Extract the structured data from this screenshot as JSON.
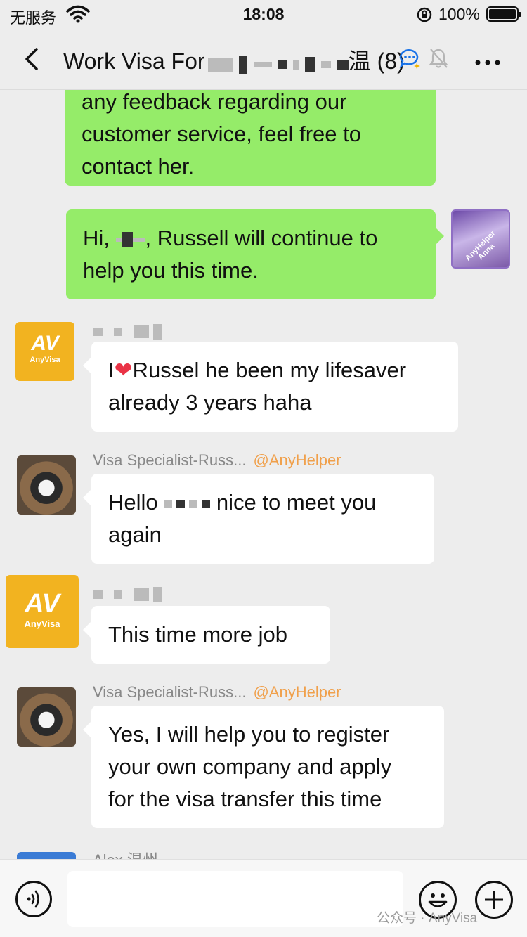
{
  "status_bar": {
    "carrier": "无服务",
    "time": "18:08",
    "battery": "100%"
  },
  "header": {
    "title_start": "Work Visa For",
    "title_end": "温",
    "member_count": "(8)"
  },
  "messages": [
    {
      "text_lines": [
        "any feedback regarding our",
        "customer service, feel free to",
        "contact her."
      ]
    },
    {
      "text_prefix": "Hi,",
      "text_rest": ", Russell will continue to",
      "text_line2": "help you this time."
    },
    {
      "line1_start": "I",
      "line1_rest": "Russel he been my lifesaver",
      "line2": "already 3 years haha"
    },
    {
      "sender": "Visa Specialist-Russ...",
      "mention": "@AnyHelper",
      "line1_start": "Hello",
      "line1_rest": "nice to meet you",
      "line2": "again"
    },
    {
      "text": "This time more job"
    },
    {
      "sender": "Visa Specialist-Russ...",
      "mention": "@AnyHelper",
      "lines": [
        "Yes, I will help you to register",
        "your own company and apply",
        "for the visa transfer this time"
      ]
    },
    {
      "sender": "Alex 温州"
    }
  ],
  "avatars": {
    "anyvisa_mark": "AV",
    "anyvisa_name": "AnyVisa",
    "anna_label_1": "AnyHelper",
    "anna_label_2": "Anna"
  },
  "watermark": "公众号 · AnyVisa",
  "icons": [
    "back-icon",
    "chat-bubble-icon",
    "mute-bell-icon",
    "more-icon",
    "voice-icon",
    "emoji-icon",
    "plus-icon",
    "heart-icon",
    "wifi-icon",
    "lock-rotation-icon"
  ],
  "colors": {
    "outgoing_bubble": "#95ec69",
    "mention": "#f0a04b",
    "anyvisa_brand": "#f2b320"
  }
}
